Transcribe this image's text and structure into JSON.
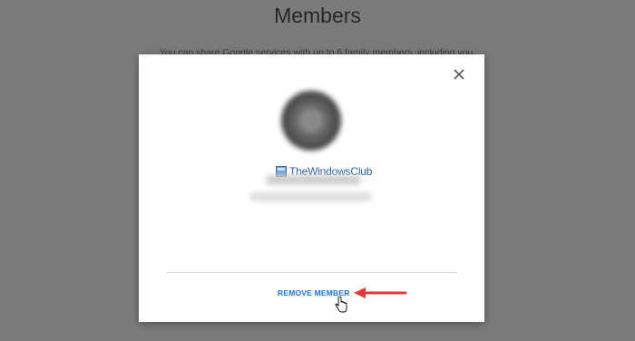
{
  "background": {
    "title": "Members",
    "subtitle": "You can share Google services with up to 6 family members, including you."
  },
  "dialog": {
    "close_icon": "close-icon",
    "avatar_icon": "blurred-avatar",
    "watermark": "TheWindowsClub",
    "remove_button": "REMOVE MEMBER"
  },
  "colors": {
    "overlay": "#7a7a7a",
    "dialog": "#ffffff",
    "button_text": "#1a73e8",
    "annotation_arrow": "#e53935"
  }
}
